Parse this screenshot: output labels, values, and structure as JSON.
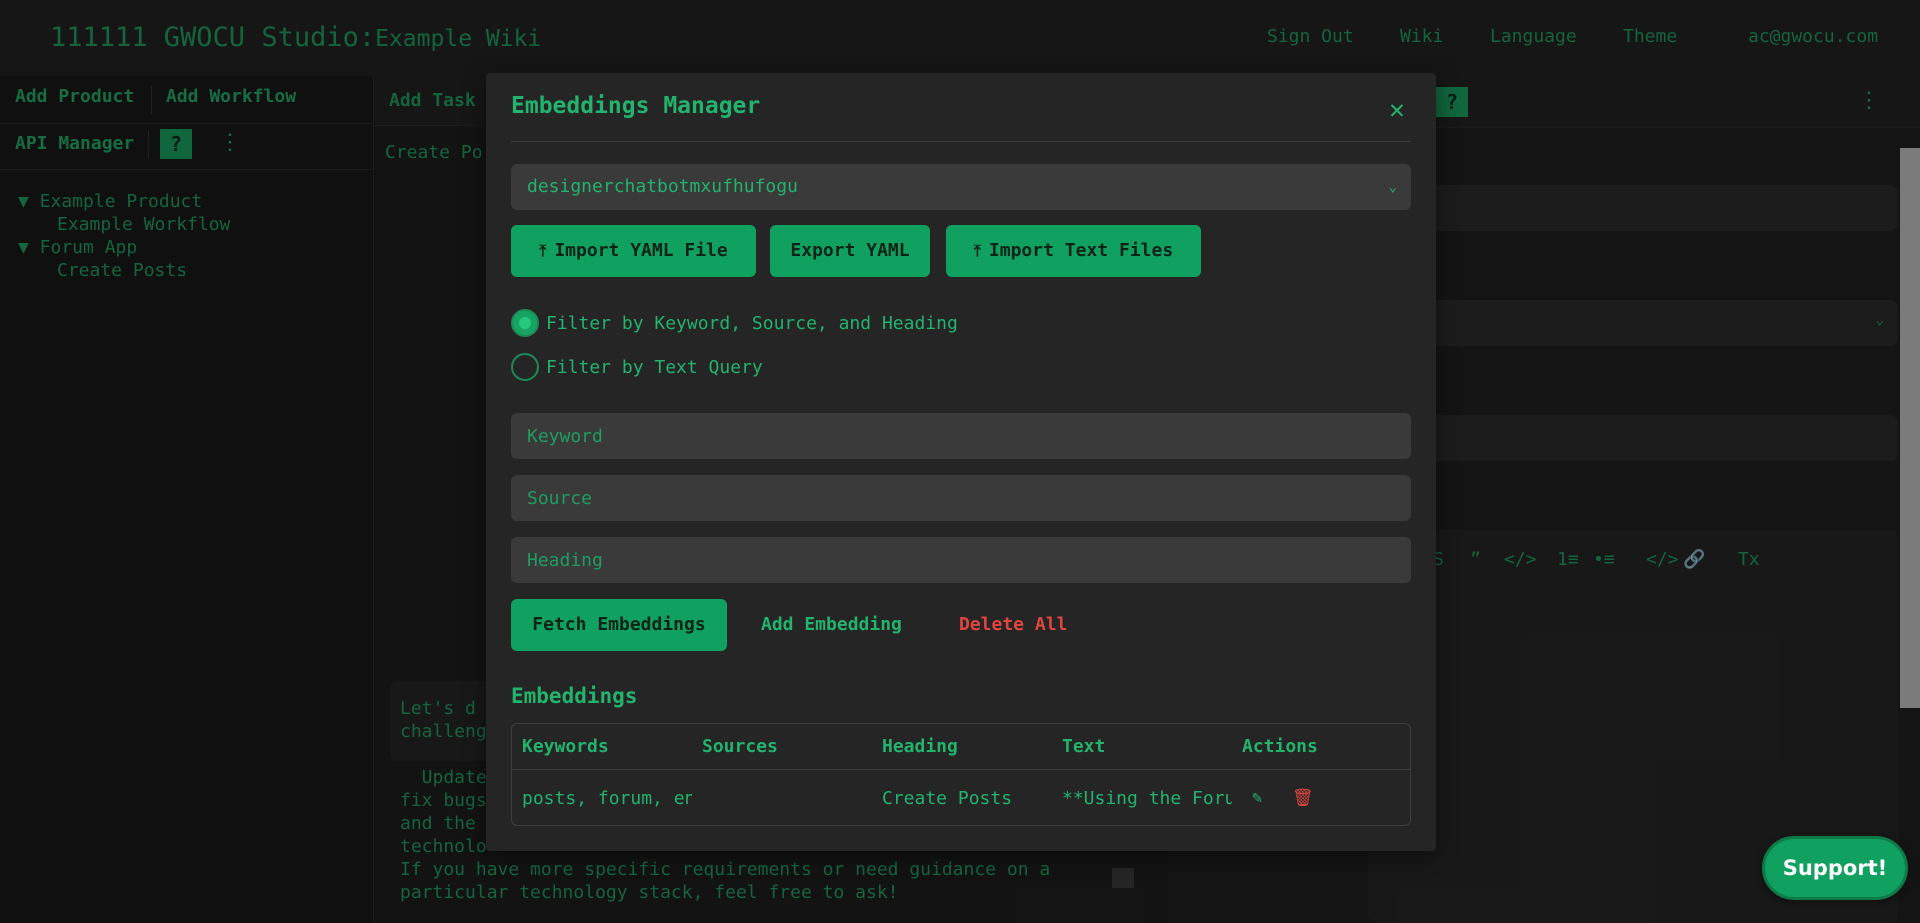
{
  "header": {
    "brand": "111111 GWOCU Studio:",
    "brand_sub": "Example Wiki",
    "nav": [
      "Sign Out",
      "Wiki",
      "Language",
      "Theme",
      "ac@gwocu.com"
    ]
  },
  "sidebar": {
    "add_product": "Add Product",
    "add_workflow": "Add Workflow",
    "api_manager": "API Manager",
    "help": "?",
    "more": "⋮",
    "tree": [
      {
        "label": "▼ Example Product"
      },
      {
        "label": "Example Workflow"
      },
      {
        "label": "▼ Forum App"
      },
      {
        "label": "Create Posts"
      }
    ]
  },
  "middle": {
    "add_task": "Add Task",
    "create_post": "Create Po",
    "bubble_lines": "Let's d\nchalleng",
    "chat_text": "  Update\nfix bugs\nand the \ntechnolo\nIf you have more specific requirements or need guidance on a\nparticular technology stack, feel free to ask!"
  },
  "right": {
    "help": "?",
    "more": "⋮",
    "toolbar": [
      "S",
      "”",
      "</>",
      "1≡",
      "•≡",
      "</>",
      "🔗",
      "Tx"
    ]
  },
  "modal": {
    "title": "Embeddings Manager",
    "close": "✕",
    "select_value": "designerchatbotmxufhufogu",
    "import_yaml": "Import YAML File",
    "export_yaml": "Export YAML",
    "import_text": "Import Text Files",
    "radio_keyword": "Filter by Keyword, Source, and Heading",
    "radio_text": "Filter by Text Query",
    "keyword_placeholder": "Keyword",
    "source_placeholder": "Source",
    "heading_placeholder": "Heading",
    "fetch": "Fetch Embeddings",
    "add": "Add Embedding",
    "delete_all": "Delete All",
    "section_title": "Embeddings",
    "table": {
      "headers": [
        "Keywords",
        "Sources",
        "Heading",
        "Text",
        "Actions"
      ],
      "rows": [
        {
          "keywords": "posts, forum, en",
          "sources": "",
          "heading": "Create Posts",
          "text": "**Using the Foru"
        }
      ]
    }
  },
  "support": "Support!",
  "colors": {
    "accent": "#10a060",
    "text_green": "#22b36d",
    "danger": "#e0463f"
  }
}
